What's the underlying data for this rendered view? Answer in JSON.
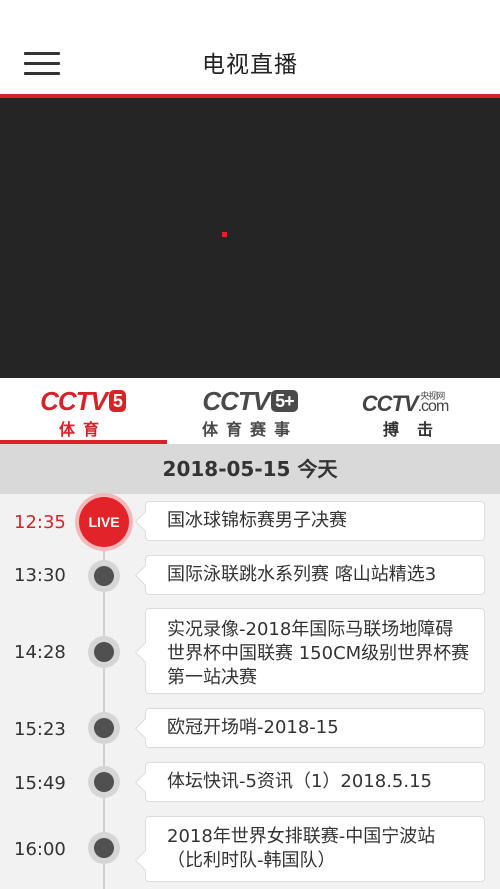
{
  "header": {
    "title": "电视直播",
    "menu_icon": "hamburger-menu-icon"
  },
  "accent_color": "#d6232a",
  "channels": [
    {
      "logo": "CCTV",
      "number": "5",
      "subtitle": "体育",
      "active": true
    },
    {
      "logo": "CCTV",
      "number": "5+",
      "subtitle": "体育赛事",
      "active": false
    },
    {
      "logo": "CCTV",
      "domain": ".com",
      "tag": "央视网",
      "subtitle": "搏击",
      "active": false
    }
  ],
  "date": "2018-05-15 今天",
  "live_label": "LIVE",
  "schedule": [
    {
      "time": "12:35",
      "title": "国冰球锦标赛男子决赛",
      "live": true
    },
    {
      "time": "13:30",
      "title": "国际泳联跳水系列赛 喀山站精选3",
      "live": false
    },
    {
      "time": "14:28",
      "title": "实况录像-2018年国际马联场地障碍世界杯中国联赛 150CM级别世界杯赛第一站决赛",
      "live": false
    },
    {
      "time": "15:23",
      "title": "欧冠开场哨-2018-15",
      "live": false
    },
    {
      "time": "15:49",
      "title": "体坛快讯-5资讯（1）2018.5.15",
      "live": false
    },
    {
      "time": "16:00",
      "title": "2018年世界女排联赛-中国宁波站（比利时队-韩国队）",
      "live": false
    }
  ]
}
